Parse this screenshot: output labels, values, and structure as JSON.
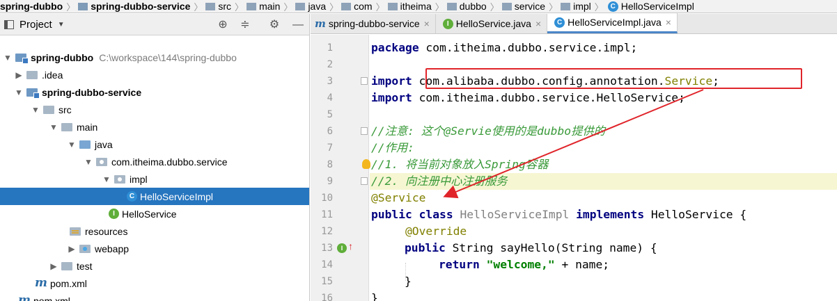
{
  "breadcrumb": [
    "spring-dubbo",
    "spring-dubbo-service",
    "src",
    "main",
    "java",
    "com",
    "itheima",
    "dubbo",
    "service",
    "impl",
    "HelloServiceImpl"
  ],
  "project_panel": {
    "title": "Project"
  },
  "tree": [
    {
      "label": "spring-dubbo",
      "path": "C:\\workspace\\144\\spring-dubbo",
      "bold": true
    },
    {
      "label": ".idea"
    },
    {
      "label": "spring-dubbo-service",
      "bold": true
    },
    {
      "label": "src"
    },
    {
      "label": "main"
    },
    {
      "label": "java"
    },
    {
      "label": "com.itheima.dubbo.service"
    },
    {
      "label": "impl"
    },
    {
      "label": "HelloServiceImpl",
      "selected": true
    },
    {
      "label": "HelloService"
    },
    {
      "label": "resources"
    },
    {
      "label": "webapp"
    },
    {
      "label": "test"
    },
    {
      "label": "pom.xml"
    },
    {
      "label": "pom.xml"
    }
  ],
  "tabs": [
    {
      "label": "spring-dubbo-service"
    },
    {
      "label": "HelloService.java"
    },
    {
      "label": "HelloServiceImpl.java",
      "active": true
    }
  ],
  "code": {
    "line_numbers": [
      "1",
      "2",
      "3",
      "4",
      "5",
      "6",
      "7",
      "8",
      "9",
      "10",
      "11",
      "12",
      "13",
      "14",
      "15",
      "16"
    ],
    "l1_kw": "package",
    "l1_rest": " com.itheima.dubbo.service.impl;",
    "l3_kw": "import",
    "l3_pkg": " com.alibaba.dubbo.config.annotation.",
    "l3_cls": "Service",
    "l3_end": ";",
    "l4_kw": "import",
    "l4_rest": " com.itheima.dubbo.service.HelloService;",
    "l6": "//注意: 这个@Servie使用的是dubbo提供的",
    "l7": "//作用:",
    "l8": "//1. 将当前对象放入Spring容器",
    "l9": "//2. 向注册中心注册服务",
    "l10": "@Service",
    "l11_kw1": "public",
    "l11_kw2": " class",
    "l11_cls": " HelloServiceImpl",
    "l11_kw3": " implements",
    "l11_rest": " HelloService {",
    "l12": "@Override",
    "l13_kw": "public",
    "l13_rest": " String sayHello(String name) {",
    "l14_kw": "return",
    "l14_str": " \"welcome,\"",
    "l14_rest": " + name;",
    "l15": "}",
    "l16": "}"
  },
  "colors": {
    "annotation_box": "#e0242a",
    "selection": "#2675bf"
  }
}
